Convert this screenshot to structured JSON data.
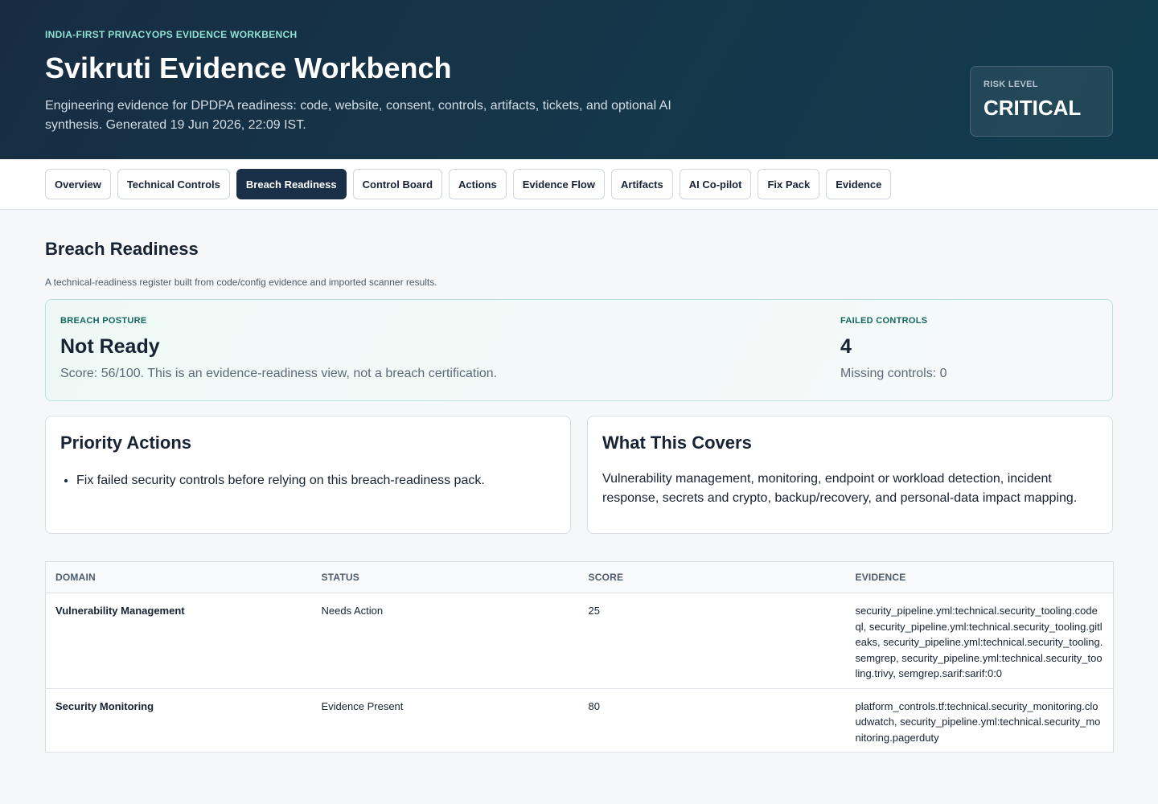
{
  "header": {
    "eyebrow": "INDIA-FIRST PRIVACYOPS EVIDENCE WORKBENCH",
    "title": "Svikruti Evidence Workbench",
    "description": "Engineering evidence for DPDPA readiness: code, website, consent, controls, artifacts, tickets, and optional AI synthesis. Generated 19 Jun 2026, 22:09 IST.",
    "risk_label": "RISK LEVEL",
    "risk_value": "CRITICAL"
  },
  "tabs": [
    {
      "label": "Overview"
    },
    {
      "label": "Technical Controls"
    },
    {
      "label": "Breach Readiness",
      "active": true
    },
    {
      "label": "Control Board"
    },
    {
      "label": "Actions"
    },
    {
      "label": "Evidence Flow"
    },
    {
      "label": "Artifacts"
    },
    {
      "label": "AI Co-pilot"
    },
    {
      "label": "Fix Pack"
    },
    {
      "label": "Evidence"
    }
  ],
  "section": {
    "title": "Breach Readiness",
    "subtitle": "A technical-readiness register built from code/config evidence and imported scanner results."
  },
  "posture": {
    "label": "BREACH POSTURE",
    "value": "Not Ready",
    "note": "Score: 56/100. This is an evidence-readiness view, not a breach certification.",
    "failed_label": "FAILED CONTROLS",
    "failed_value": "4",
    "missing_note": "Missing controls: 0"
  },
  "priority": {
    "title": "Priority Actions",
    "items": [
      "Fix failed security controls before relying on this breach-readiness pack."
    ]
  },
  "covers": {
    "title": "What This Covers",
    "text": "Vulnerability management, monitoring, endpoint or workload detection, incident response, secrets and crypto, backup/recovery, and personal-data impact mapping."
  },
  "table": {
    "headers": [
      "DOMAIN",
      "STATUS",
      "SCORE",
      "EVIDENCE"
    ],
    "rows": [
      {
        "domain": "Vulnerability Management",
        "status": "Needs Action",
        "score": "25",
        "evidence": "security_pipeline.yml:technical.security_tooling.codeql, security_pipeline.yml:technical.security_tooling.gitleaks, security_pipeline.yml:technical.security_tooling.semgrep, security_pipeline.yml:technical.security_tooling.trivy, semgrep.sarif:sarif:0:0"
      },
      {
        "domain": "Security Monitoring",
        "status": "Evidence Present",
        "score": "80",
        "evidence": "platform_controls.tf:technical.security_monitoring.cloudwatch, security_pipeline.yml:technical.security_monitoring.pagerduty"
      }
    ]
  }
}
